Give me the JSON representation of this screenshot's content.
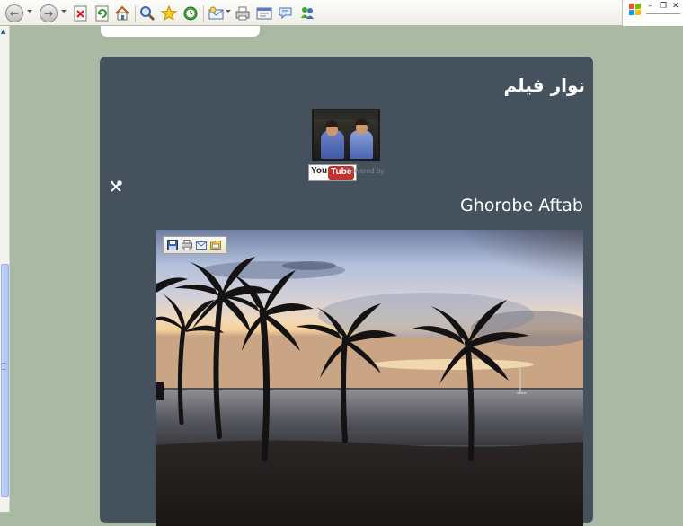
{
  "toolbar": {
    "back_label": "Back",
    "forward_label": "Forward",
    "icons": [
      "back-icon",
      "forward-icon",
      "stop-icon",
      "refresh-icon",
      "home-icon",
      "search-icon",
      "favorites-icon",
      "history-icon",
      "mail-icon",
      "print-icon",
      "edit-icon",
      "discuss-icon",
      "messenger-icon"
    ]
  },
  "panel": {
    "arabic_title": "نوار فیلم",
    "powered_by": "Powered by",
    "youtube_you": "You",
    "youtube_tube": "Tube",
    "post_title": "Ghorobe Aftab"
  },
  "colors": {
    "page_background": "#a9b9a4",
    "panel_background": "#45525e",
    "title_text": "#ffffff"
  }
}
